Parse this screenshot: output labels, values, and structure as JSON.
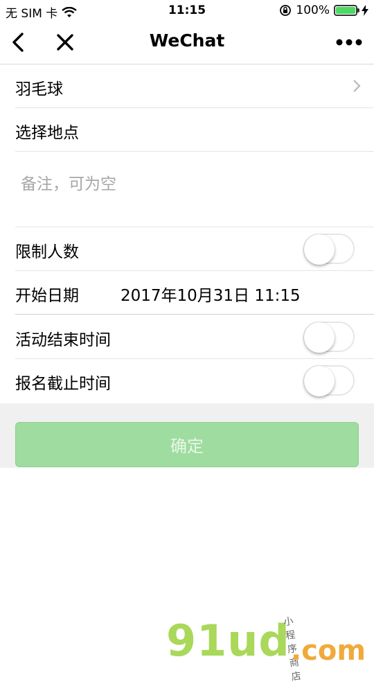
{
  "status_bar": {
    "carrier": "无 SIM 卡",
    "time": "11:15",
    "battery_percent": "100%",
    "battery_level": 1.0
  },
  "nav": {
    "title": "WeChat",
    "back_icon": "chevron-left-icon",
    "close_icon": "close-icon",
    "more_icon": "more-dots-icon"
  },
  "form": {
    "category": "羽毛球",
    "location_label": "选择地点",
    "note_placeholder": "备注，可为空",
    "limit_label": "限制人数",
    "limit_on": false,
    "start_label": "开始日期",
    "start_value": "2017年10月31日 11:15",
    "end_time_label": "活动结束时间",
    "end_time_on": false,
    "deadline_label": "报名截止时间",
    "deadline_on": false
  },
  "confirm_label": "确定",
  "watermark": {
    "brand": "91ud",
    "suffix": ".com",
    "tagline": "小程序商店"
  },
  "colors": {
    "confirm_bg": "#9fdc9f",
    "battery": "#4cd964"
  }
}
